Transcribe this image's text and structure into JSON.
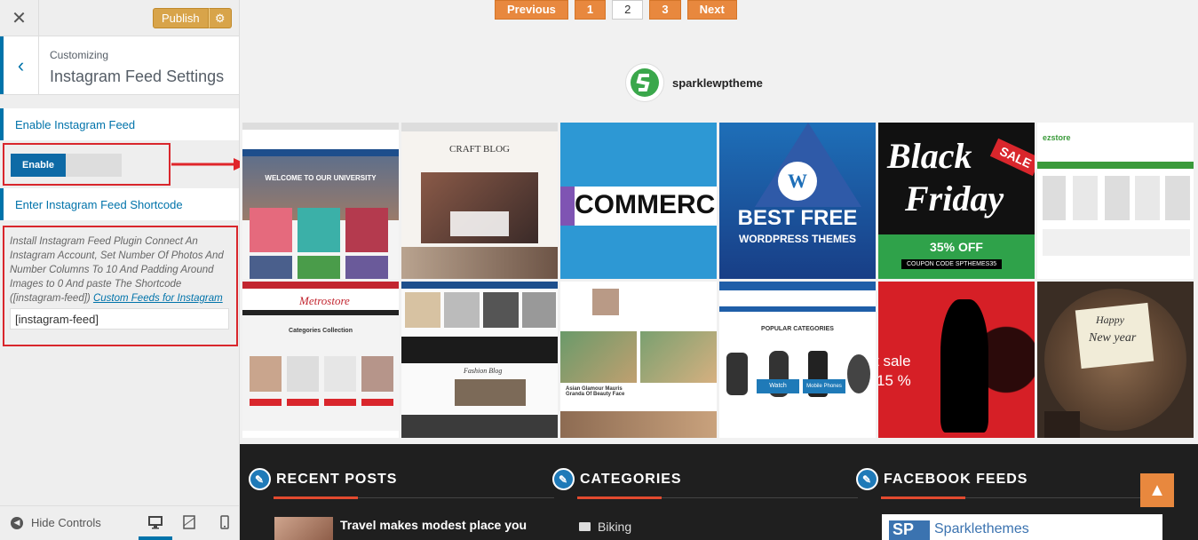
{
  "sidebar": {
    "close_glyph": "✕",
    "publish_label": "Publish",
    "title_small": "Customizing",
    "title_big": "Instagram Feed Settings",
    "section_enable": "Enable Instagram Feed",
    "toggle_label": "Enable",
    "section_shortcode": "Enter Instagram Feed Shortcode",
    "description": "Install Instagram Feed Plugin Connect An Instagram Account, Set Number Of Photos And Number Columns To 10 And Padding Around Images to 0 And paste The Shortcode ([instagram-feed])",
    "description_link": "Custom Feeds for Instagram",
    "shortcode_value": "[instagram-feed]",
    "hide_controls": "Hide Controls",
    "accent_color": "#0073aa",
    "highlight_color": "#d9262c"
  },
  "preview": {
    "pagination": [
      "Previous",
      "1",
      "2",
      "3",
      "Next"
    ],
    "current_page": "2",
    "instagram_user": "sparklewptheme",
    "tiles": [
      {
        "name": "university-theme",
        "top": "WELCOME TO OUR UNIVERSITY"
      },
      {
        "name": "craft-blog",
        "top": "CRAFT BLOG"
      },
      {
        "name": "woocommerce",
        "top": "COMMERC"
      },
      {
        "name": "wordpress-themes",
        "top": "BEST FREE",
        "sub": "WORDPRESS THEMES"
      },
      {
        "name": "black-friday",
        "top": "Black",
        "sub": "Friday",
        "extra": "35% OFF",
        "code": "COUPON CODE  SPTHEMES35",
        "tag": "SALE"
      },
      {
        "name": "ezstore",
        "top": "ezstore"
      },
      {
        "name": "metrostore",
        "top": "Metrostore",
        "sub": "Categories Collection"
      },
      {
        "name": "fashion-blog",
        "top": "Fashion Blog"
      },
      {
        "name": "asian-glamour",
        "top": "Asian Glamour Mauris Granda Of Beauty Face"
      },
      {
        "name": "store-pro",
        "top": "POPULAR CATEGORIES",
        "sub": "Watch",
        "extra": "Mobile Phones"
      },
      {
        "name": "sale-silhouette",
        "top": "t sale",
        "sub": "15 %"
      },
      {
        "name": "happy-new-year",
        "top": "Happy",
        "sub": "New year"
      }
    ],
    "footer": {
      "recent_posts": "RECENT POSTS",
      "categories": "CATEGORIES",
      "facebook_feeds": "FACEBOOK FEEDS",
      "post_title": "Travel makes modest place you",
      "category_item": "Biking",
      "fb_page": "Sparklethemes",
      "fb_logo": "SP"
    }
  }
}
